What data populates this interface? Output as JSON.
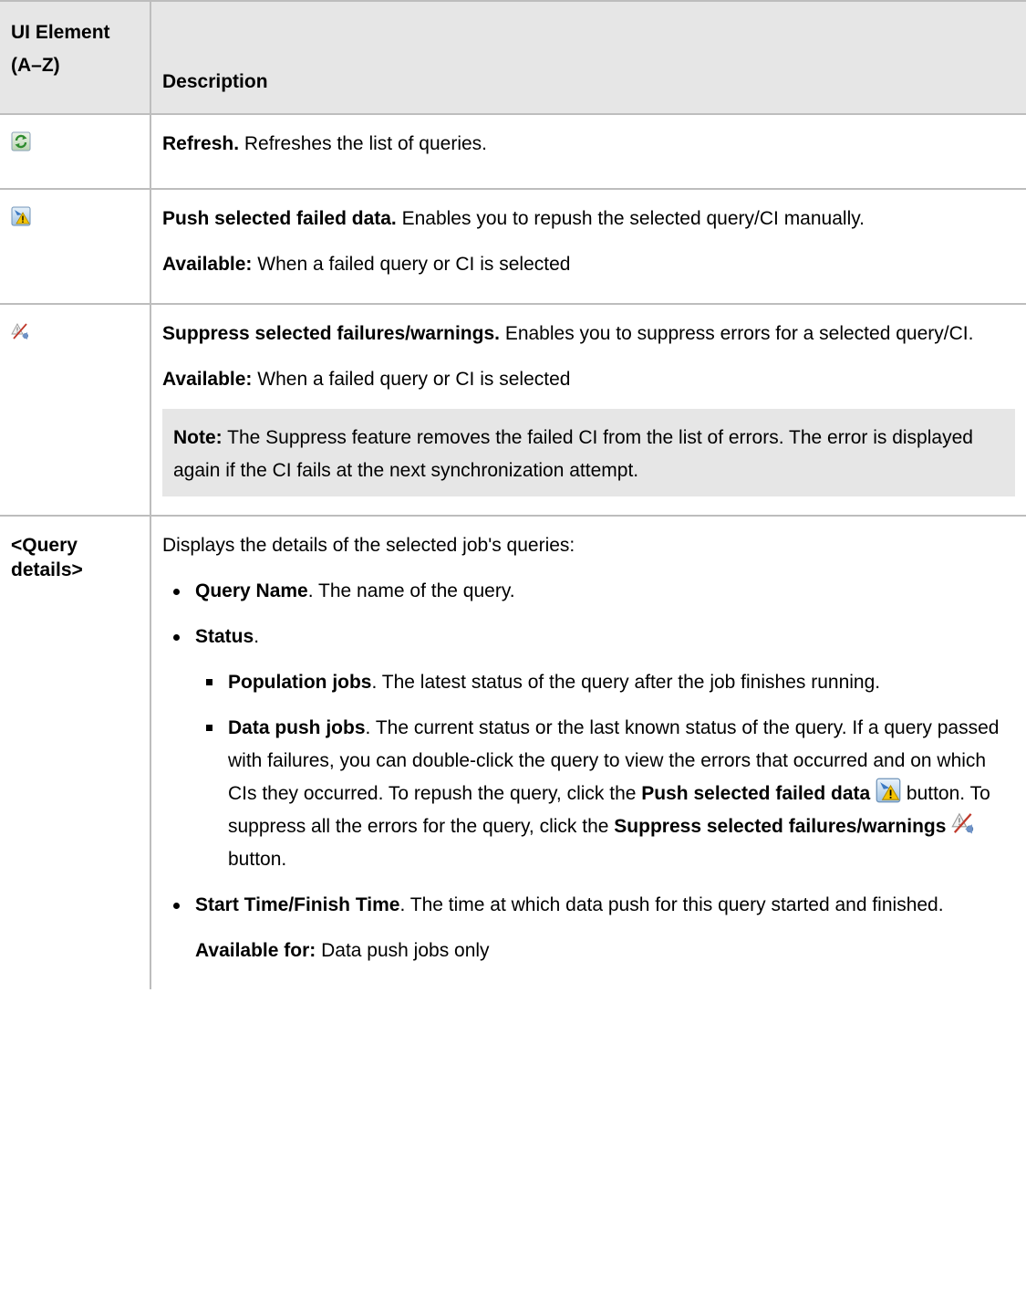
{
  "header": {
    "col1": "UI Element (A–Z)",
    "col2": "Description"
  },
  "rows": {
    "refresh": {
      "icon": "refresh-icon",
      "title": "Refresh.",
      "text": " Refreshes the list of queries."
    },
    "push": {
      "icon": "push-failed-data-icon",
      "title": "Push selected failed data.",
      "text": " Enables you to repush the selected query/CI manually.",
      "avail_label": "Available:",
      "avail_text": " When a failed query or CI is selected"
    },
    "suppress": {
      "icon": "suppress-failures-icon",
      "title": "Suppress selected failures/warnings.",
      "text": " Enables you to suppress errors for a selected query/CI.",
      "avail_label": "Available:",
      "avail_text": " When a failed query or CI is selected",
      "note_label": "Note:",
      "note_text": " The Suppress feature removes the failed CI from the list of errors. The error is displayed again if the CI fails at the next synchronization attempt."
    },
    "query": {
      "label": "<Query details>",
      "intro": "Displays the details of the selected job's queries:",
      "b1_title": "Query Name",
      "b1_text": ". The name of the query.",
      "b2_title": "Status",
      "b2_text": ".",
      "s1_title": "Population jobs",
      "s1_text": ". The latest status of the query after the job finishes running.",
      "s2_title": "Data push jobs",
      "s2_text_a": ". The current status or the last known status of the query. If a query passed with failures, you can double-click the query to view the errors that occurred and on which CIs they occurred. To repush the query, click the ",
      "s2_push_label": "Push selected failed data",
      "s2_text_b": " button. To suppress all the errors for the query, click the ",
      "s2_suppress_label": "Suppress selected failures/warnings",
      "s2_text_c": " button.",
      "b3_title": "Start Time/Finish Time",
      "b3_text": ". The time at which data push for this query started and finished.",
      "avail_label": "Available for:",
      "avail_text": " Data push jobs only"
    }
  }
}
